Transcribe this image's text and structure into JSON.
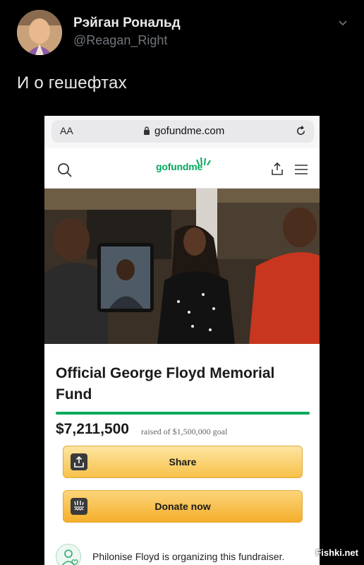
{
  "tweet": {
    "author_name": "Рэйган Рональд",
    "author_handle": "@Reagan_Right",
    "text": "И о гешефтах"
  },
  "browser": {
    "text_size_label": "AA",
    "url": "gofundme.com"
  },
  "site": {
    "logo_text": "gofundme"
  },
  "fundraiser": {
    "title": "Official George Floyd Memorial Fund",
    "raised": "$7,211,500",
    "goal_text": "raised of $1,500,000 goal",
    "progress_fraction": 1.0,
    "share_label": "Share",
    "donate_label": "Donate now",
    "organizer_text": "Philonise Floyd is organizing this fundraiser."
  },
  "watermark": "Fishki.net",
  "colors": {
    "brand_green": "#02a95c",
    "button_yellow": "#f7c14a"
  }
}
